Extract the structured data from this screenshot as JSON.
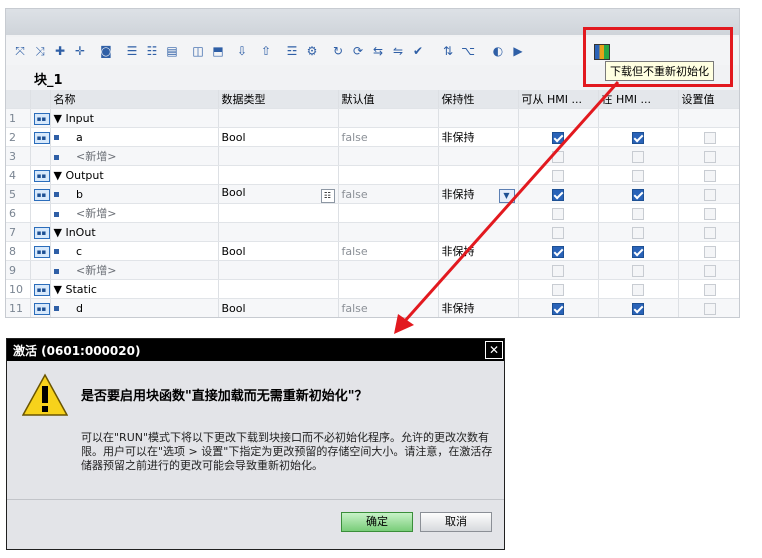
{
  "block_title": "块_1",
  "columns": [
    "名称",
    "数据类型",
    "默认值",
    "保持性",
    "可从 HMI ...",
    "在 HMI ...",
    "设置值"
  ],
  "rows": [
    {
      "num": "1",
      "kind": "section",
      "name": "Input",
      "type": "",
      "default": "",
      "retain": "",
      "hmi_access": null,
      "hmi_visible": null,
      "setpoint": null
    },
    {
      "num": "2",
      "kind": "var",
      "name": "a",
      "type": "Bool",
      "default": "false",
      "retain": "非保持",
      "hmi_access": true,
      "hmi_visible": true,
      "setpoint": false
    },
    {
      "num": "3",
      "kind": "new",
      "name": "<新增>",
      "type": "",
      "default": "",
      "retain": "",
      "hmi_access": false,
      "hmi_visible": false,
      "setpoint": false
    },
    {
      "num": "4",
      "kind": "section",
      "name": "Output",
      "type": "",
      "default": "",
      "retain": "",
      "hmi_access": false,
      "hmi_visible": false,
      "setpoint": false
    },
    {
      "num": "5",
      "kind": "var",
      "name": "b",
      "type": "Bool",
      "default": "false",
      "retain": "非保持",
      "hmi_access": true,
      "hmi_visible": true,
      "setpoint": false
    },
    {
      "num": "6",
      "kind": "new",
      "name": "<新增>",
      "type": "",
      "default": "",
      "retain": "",
      "hmi_access": false,
      "hmi_visible": false,
      "setpoint": false
    },
    {
      "num": "7",
      "kind": "section",
      "name": "InOut",
      "type": "",
      "default": "",
      "retain": "",
      "hmi_access": false,
      "hmi_visible": false,
      "setpoint": false
    },
    {
      "num": "8",
      "kind": "var",
      "name": "c",
      "type": "Bool",
      "default": "false",
      "retain": "非保持",
      "hmi_access": true,
      "hmi_visible": true,
      "setpoint": false
    },
    {
      "num": "9",
      "kind": "new",
      "name": "<新增>",
      "type": "",
      "default": "",
      "retain": "",
      "hmi_access": false,
      "hmi_visible": false,
      "setpoint": false
    },
    {
      "num": "10",
      "kind": "section",
      "name": "Static",
      "type": "",
      "default": "",
      "retain": "",
      "hmi_access": false,
      "hmi_visible": false,
      "setpoint": false
    },
    {
      "num": "11",
      "kind": "var",
      "name": "d",
      "type": "Bool",
      "default": "false",
      "retain": "非保持",
      "hmi_access": true,
      "hmi_visible": true,
      "setpoint": false
    }
  ],
  "tooltip": "下载但不重新初始化",
  "dialog": {
    "title": "激活 (0601:000020)",
    "close_glyph": "✕",
    "question": "是否要启用块函数\"直接加载而无需重新初始化\"？",
    "body": "可以在\"RUN\"模式下将以下更改下载到块接口而不必初始化程序。允许的更改次数有限。用户可以在\"选项 > 设置\"下指定为更改预留的存储空间大小。请注意，在激活存储器预留之前进行的更改可能会导致重新初始化。",
    "ok_label": "确定",
    "cancel_label": "取消"
  },
  "colors": {
    "highlight": "#e2191f",
    "title_bar": "#000000",
    "ok_button": "#79cd79",
    "checkbox_on": "#2a63b8"
  }
}
